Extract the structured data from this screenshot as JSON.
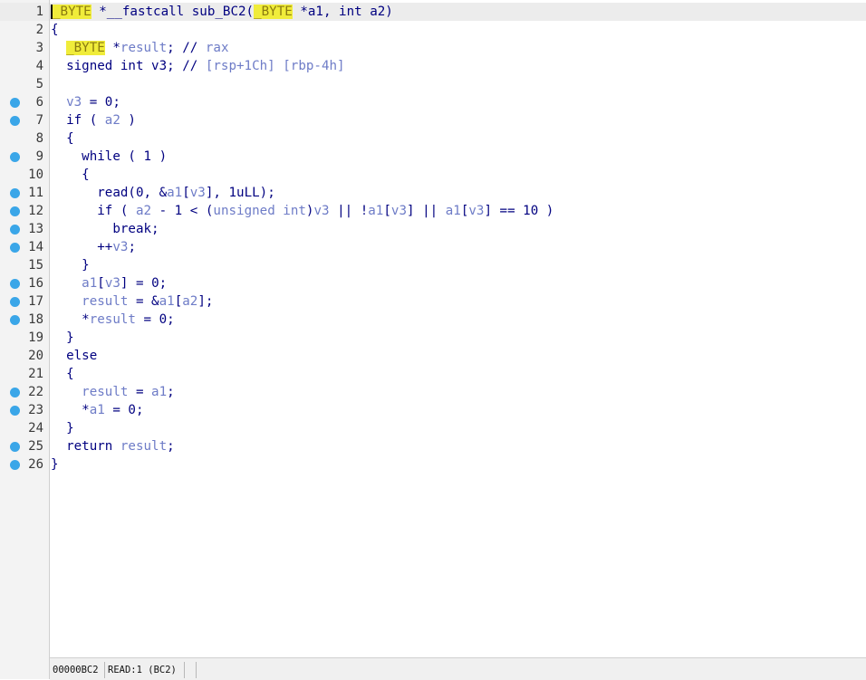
{
  "editor": {
    "lines": [
      {
        "num": "1",
        "bp": false,
        "current": true,
        "tokens": [
          {
            "t": "_BYTE",
            "c": "hl-cursor"
          },
          {
            "t": " *__fastcall sub_BC2(",
            "c": "kw"
          },
          {
            "t": "_BYTE",
            "c": "hl"
          },
          {
            "t": " *a1, int a2)",
            "c": "kw"
          }
        ]
      },
      {
        "num": "2",
        "bp": false,
        "current": false,
        "tokens": [
          {
            "t": "{",
            "c": "kw"
          }
        ]
      },
      {
        "num": "3",
        "bp": false,
        "current": false,
        "tokens": [
          {
            "t": "  ",
            "c": "kw"
          },
          {
            "t": "_BYTE",
            "c": "hl"
          },
          {
            "t": " *",
            "c": "kw"
          },
          {
            "t": "result",
            "c": "var"
          },
          {
            "t": "; // ",
            "c": "kw"
          },
          {
            "t": "rax",
            "c": "cm"
          }
        ]
      },
      {
        "num": "4",
        "bp": false,
        "current": false,
        "tokens": [
          {
            "t": "  signed int v3; // ",
            "c": "kw"
          },
          {
            "t": "[rsp+1Ch] [rbp-4h]",
            "c": "cm"
          }
        ]
      },
      {
        "num": "5",
        "bp": false,
        "current": false,
        "tokens": []
      },
      {
        "num": "6",
        "bp": true,
        "current": false,
        "tokens": [
          {
            "t": "  ",
            "c": "kw"
          },
          {
            "t": "v3",
            "c": "var"
          },
          {
            "t": " = 0;",
            "c": "kw"
          }
        ]
      },
      {
        "num": "7",
        "bp": true,
        "current": false,
        "tokens": [
          {
            "t": "  if ( ",
            "c": "kw"
          },
          {
            "t": "a2",
            "c": "var"
          },
          {
            "t": " )",
            "c": "kw"
          }
        ]
      },
      {
        "num": "8",
        "bp": false,
        "current": false,
        "tokens": [
          {
            "t": "  {",
            "c": "kw"
          }
        ]
      },
      {
        "num": "9",
        "bp": true,
        "current": false,
        "tokens": [
          {
            "t": "    while ( 1 )",
            "c": "kw"
          }
        ]
      },
      {
        "num": "10",
        "bp": false,
        "current": false,
        "tokens": [
          {
            "t": "    {",
            "c": "kw"
          }
        ]
      },
      {
        "num": "11",
        "bp": true,
        "current": false,
        "tokens": [
          {
            "t": "      read(0, &",
            "c": "kw"
          },
          {
            "t": "a1",
            "c": "var"
          },
          {
            "t": "[",
            "c": "kw"
          },
          {
            "t": "v3",
            "c": "var"
          },
          {
            "t": "], 1uLL);",
            "c": "kw"
          }
        ]
      },
      {
        "num": "12",
        "bp": true,
        "current": false,
        "tokens": [
          {
            "t": "      if ( ",
            "c": "kw"
          },
          {
            "t": "a2",
            "c": "var"
          },
          {
            "t": " - 1 < (",
            "c": "kw"
          },
          {
            "t": "unsigned int",
            "c": "var"
          },
          {
            "t": ")",
            "c": "kw"
          },
          {
            "t": "v3",
            "c": "var"
          },
          {
            "t": " || !",
            "c": "kw"
          },
          {
            "t": "a1",
            "c": "var"
          },
          {
            "t": "[",
            "c": "kw"
          },
          {
            "t": "v3",
            "c": "var"
          },
          {
            "t": "] || ",
            "c": "kw"
          },
          {
            "t": "a1",
            "c": "var"
          },
          {
            "t": "[",
            "c": "kw"
          },
          {
            "t": "v3",
            "c": "var"
          },
          {
            "t": "] == 10 )",
            "c": "kw"
          }
        ]
      },
      {
        "num": "13",
        "bp": true,
        "current": false,
        "tokens": [
          {
            "t": "        break;",
            "c": "kw"
          }
        ]
      },
      {
        "num": "14",
        "bp": true,
        "current": false,
        "tokens": [
          {
            "t": "      ++",
            "c": "kw"
          },
          {
            "t": "v3",
            "c": "var"
          },
          {
            "t": ";",
            "c": "kw"
          }
        ]
      },
      {
        "num": "15",
        "bp": false,
        "current": false,
        "tokens": [
          {
            "t": "    }",
            "c": "kw"
          }
        ]
      },
      {
        "num": "16",
        "bp": true,
        "current": false,
        "tokens": [
          {
            "t": "    ",
            "c": "kw"
          },
          {
            "t": "a1",
            "c": "var"
          },
          {
            "t": "[",
            "c": "kw"
          },
          {
            "t": "v3",
            "c": "var"
          },
          {
            "t": "] = 0;",
            "c": "kw"
          }
        ]
      },
      {
        "num": "17",
        "bp": true,
        "current": false,
        "tokens": [
          {
            "t": "    ",
            "c": "kw"
          },
          {
            "t": "result",
            "c": "var"
          },
          {
            "t": " = &",
            "c": "kw"
          },
          {
            "t": "a1",
            "c": "var"
          },
          {
            "t": "[",
            "c": "kw"
          },
          {
            "t": "a2",
            "c": "var"
          },
          {
            "t": "];",
            "c": "kw"
          }
        ]
      },
      {
        "num": "18",
        "bp": true,
        "current": false,
        "tokens": [
          {
            "t": "    *",
            "c": "kw"
          },
          {
            "t": "result",
            "c": "var"
          },
          {
            "t": " = 0;",
            "c": "kw"
          }
        ]
      },
      {
        "num": "19",
        "bp": false,
        "current": false,
        "tokens": [
          {
            "t": "  }",
            "c": "kw"
          }
        ]
      },
      {
        "num": "20",
        "bp": false,
        "current": false,
        "tokens": [
          {
            "t": "  else",
            "c": "kw"
          }
        ]
      },
      {
        "num": "21",
        "bp": false,
        "current": false,
        "tokens": [
          {
            "t": "  {",
            "c": "kw"
          }
        ]
      },
      {
        "num": "22",
        "bp": true,
        "current": false,
        "tokens": [
          {
            "t": "    ",
            "c": "kw"
          },
          {
            "t": "result",
            "c": "var"
          },
          {
            "t": " = ",
            "c": "kw"
          },
          {
            "t": "a1",
            "c": "var"
          },
          {
            "t": ";",
            "c": "kw"
          }
        ]
      },
      {
        "num": "23",
        "bp": true,
        "current": false,
        "tokens": [
          {
            "t": "    *",
            "c": "kw"
          },
          {
            "t": "a1",
            "c": "var"
          },
          {
            "t": " = 0;",
            "c": "kw"
          }
        ]
      },
      {
        "num": "24",
        "bp": false,
        "current": false,
        "tokens": [
          {
            "t": "  }",
            "c": "kw"
          }
        ]
      },
      {
        "num": "25",
        "bp": true,
        "current": false,
        "tokens": [
          {
            "t": "  return ",
            "c": "kw"
          },
          {
            "t": "result",
            "c": "var"
          },
          {
            "t": ";",
            "c": "kw"
          }
        ]
      },
      {
        "num": "26",
        "bp": true,
        "current": false,
        "tokens": [
          {
            "t": "}",
            "c": "kw"
          }
        ]
      }
    ]
  },
  "status": {
    "address": "00000BC2",
    "location": "READ:1 (BC2)"
  },
  "colors": {
    "breakpoint": "#3aa6e8",
    "keyword": "#000080",
    "variable": "#6e7cc7",
    "highlight": "#f0ec3a"
  }
}
